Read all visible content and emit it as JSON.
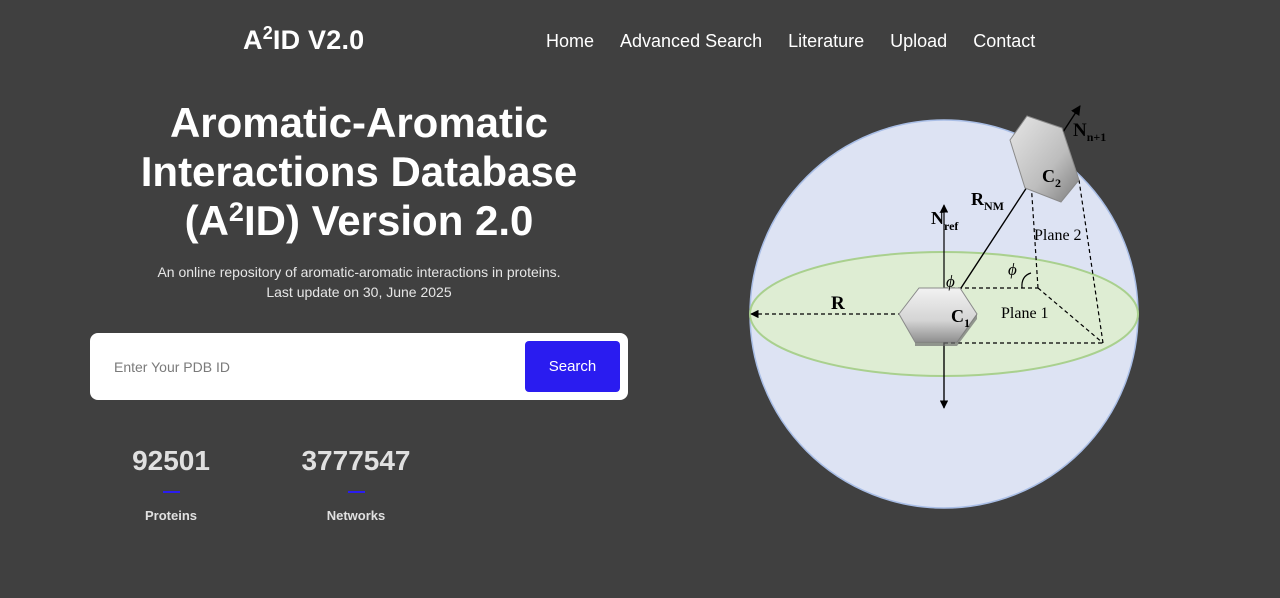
{
  "header": {
    "brand_prefix": "A",
    "brand_sup": "2",
    "brand_suffix": "ID V2.0",
    "nav": [
      {
        "label": "Home"
      },
      {
        "label": "Advanced Search"
      },
      {
        "label": "Literature"
      },
      {
        "label": "Upload"
      },
      {
        "label": "Contact"
      }
    ]
  },
  "hero": {
    "title_line1": "Aromatic-Aromatic",
    "title_line2": "Interactions Database",
    "title_line3_prefix": "(A",
    "title_line3_sup": "2",
    "title_line3_suffix": "ID) Version 2.0",
    "subtitle_line1": "An online repository of aromatic-aromatic interactions in proteins.",
    "subtitle_line2": "Last update on 30, June 2025"
  },
  "search": {
    "placeholder": "Enter Your PDB ID",
    "value": "",
    "button_label": "Search"
  },
  "stats": [
    {
      "value": "92501",
      "label": "Proteins"
    },
    {
      "value": "3777547",
      "label": "Networks"
    }
  ],
  "diagram": {
    "labels": {
      "n_next": "N",
      "n_next_sub": "n+1",
      "c2": "C",
      "c2_sub": "2",
      "rnm": "R",
      "rnm_sub": "NM",
      "nref": "N",
      "nref_sub": "ref",
      "plane2": "Plane 2",
      "phi_1": "ϕ",
      "phi_2": "ϕ",
      "r": "R",
      "c1": "C",
      "c1_sub": "1",
      "plane1": "Plane 1"
    },
    "colors": {
      "sphere": "#dde3f3",
      "sphere_stroke": "#a9bee6",
      "plane": "#deedd3",
      "plane_stroke": "#a9d08e"
    }
  }
}
